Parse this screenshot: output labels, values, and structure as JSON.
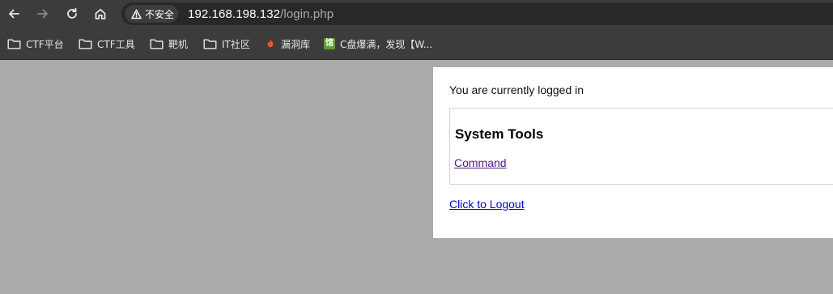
{
  "browser": {
    "security_label": "不安全",
    "url_host": "192.168.198.132",
    "url_path": "/login.php",
    "bookmarks": [
      {
        "label": "CTF平台",
        "icon": "folder-icon"
      },
      {
        "label": "CTF工具",
        "icon": "folder-icon"
      },
      {
        "label": "靶机",
        "icon": "folder-icon"
      },
      {
        "label": "IT社区",
        "icon": "folder-icon"
      },
      {
        "label": "漏洞库",
        "icon": "fire-icon"
      },
      {
        "label": "C盘爆满，发现【W...",
        "icon": "guan-icon",
        "icon_glyph": "馆"
      }
    ]
  },
  "page": {
    "status_text": "You are currently logged in",
    "tools_heading": "System Tools",
    "command_link": "Command",
    "logout_link": "Click to Logout"
  },
  "colors": {
    "page_background": "#aaaaaa",
    "visited_link": "#551a8b",
    "link": "#0000ee"
  }
}
